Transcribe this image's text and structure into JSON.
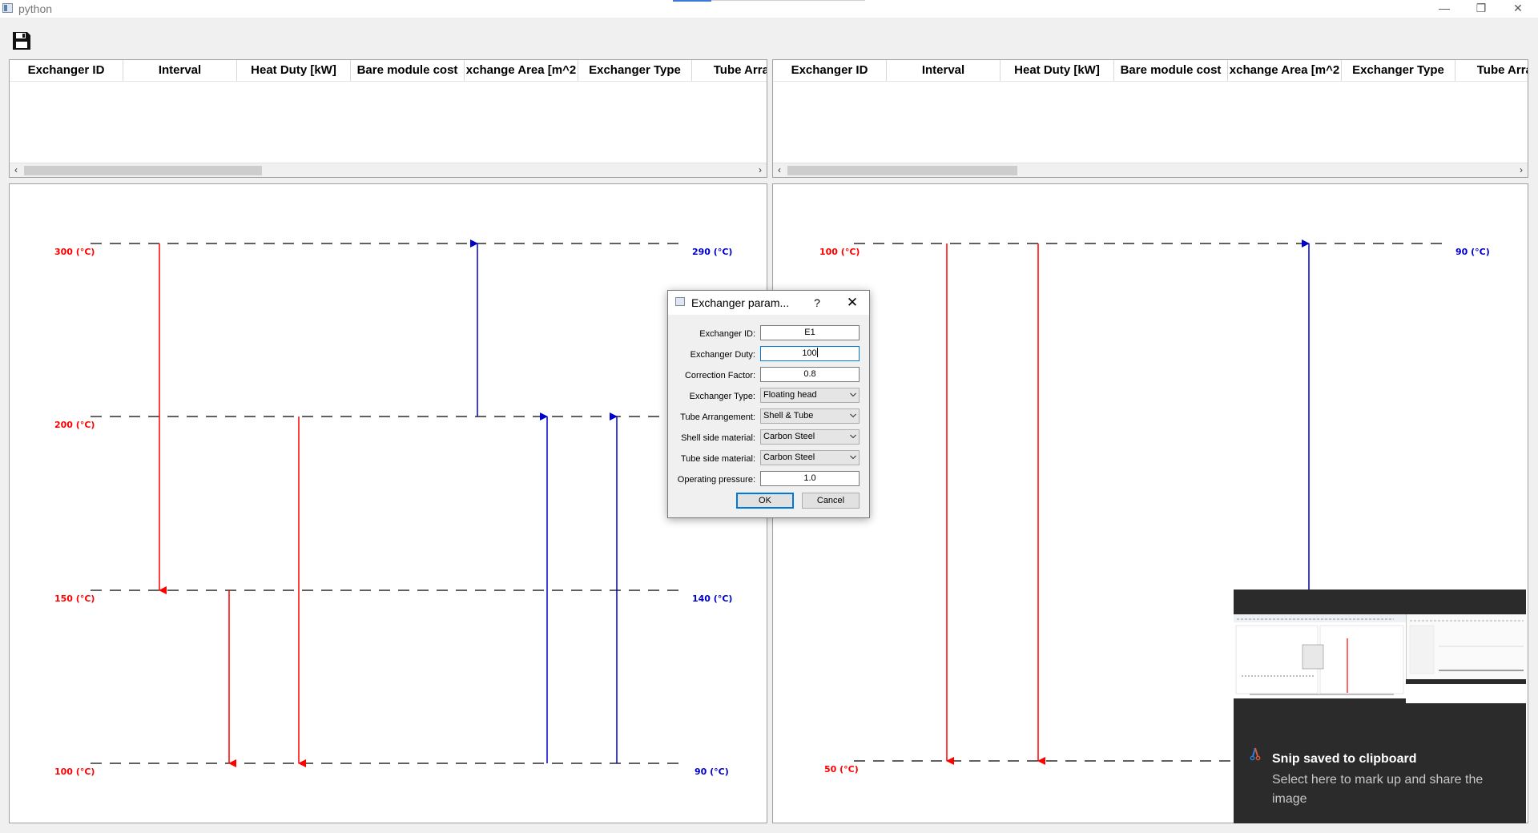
{
  "window": {
    "title": "python",
    "minimize_icon": "—",
    "restore_icon": "❐",
    "close_icon": "✕"
  },
  "toolbar": {
    "save_icon": "floppy-disk-icon"
  },
  "left_table": {
    "columns": [
      "Exchanger ID",
      "Interval",
      "Heat Duty [kW]",
      "Bare module cost",
      "xchange Area [m^2",
      "Exchanger Type",
      "Tube Arrang"
    ]
  },
  "right_table": {
    "columns": [
      "Exchanger ID",
      "Interval",
      "Heat Duty [kW]",
      "Bare module cost",
      "xchange Area [m^2",
      "Exchanger Type",
      "Tube Arrang"
    ]
  },
  "scroll": {
    "left_arrow": "‹",
    "right_arrow": "›"
  },
  "left_graph": {
    "hot_labels": [
      "300 (°C)",
      "200 (°C)",
      "150 (°C)",
      "100 (°C)"
    ],
    "cold_labels": [
      "290 (°C)",
      "140 (°C)",
      "90 (°C)"
    ],
    "colors": {
      "hot": "#ff0000",
      "cold": "#0000cc"
    }
  },
  "right_graph": {
    "hot_labels": [
      "100 (°C)",
      "50 (°C)"
    ],
    "cold_labels": [
      "90 (°C)"
    ],
    "colors": {
      "hot": "#ff0000",
      "cold": "#0000cc"
    }
  },
  "dialog": {
    "title": "Exchanger param...",
    "help": "?",
    "close": "✕",
    "fields": {
      "exchanger_id": {
        "label": "Exchanger ID:",
        "value": "E1"
      },
      "exchanger_duty": {
        "label": "Exchanger Duty:",
        "value": "100"
      },
      "correction_factor": {
        "label": "Correction Factor:",
        "value": "0.8"
      },
      "exchanger_type": {
        "label": "Exchanger Type:",
        "value": "Floating head"
      },
      "tube_arrangement": {
        "label": "Tube Arrangement:",
        "value": "Shell & Tube"
      },
      "shell_side_material": {
        "label": "Shell side material:",
        "value": "Carbon Steel"
      },
      "tube_side_material": {
        "label": "Tube side material:",
        "value": "Carbon Steel"
      },
      "operating_pressure": {
        "label": "Operating pressure:",
        "value": "1.0"
      }
    },
    "ok_label": "OK",
    "cancel_label": "Cancel"
  },
  "snip_notification": {
    "title": "Snip saved to clipboard",
    "message": "Select here to mark up and share the image"
  }
}
